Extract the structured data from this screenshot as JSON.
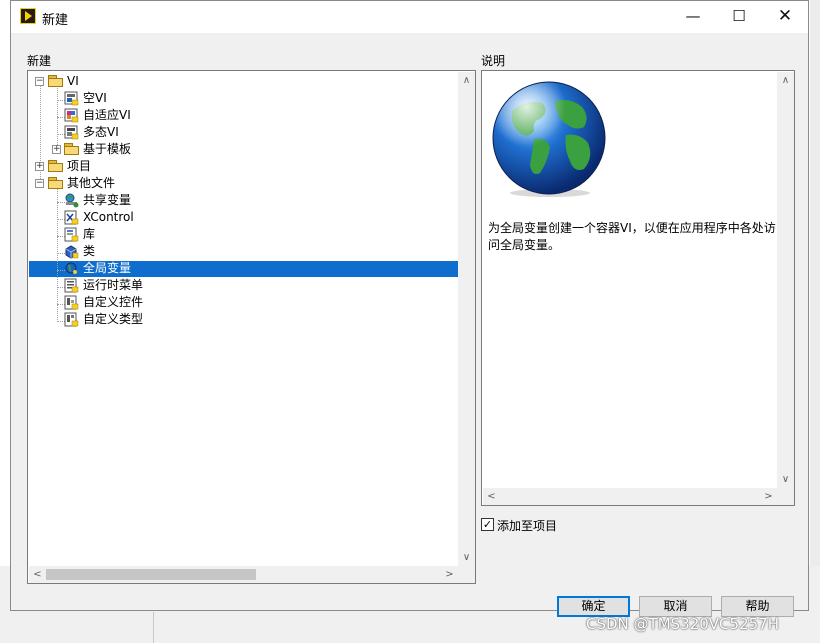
{
  "window": {
    "title": "新建",
    "minimize_glyph": "—",
    "maximize_glyph": "☐",
    "close_glyph": "✕"
  },
  "tree_section_label": "新建",
  "description_section_label": "说明",
  "tree": [
    {
      "label": "VI",
      "expanded": true,
      "icon": "folder-icon"
    },
    {
      "label": "空VI",
      "icon": "vi-icon"
    },
    {
      "label": "自适应VI",
      "icon": "adaptive-vi-icon"
    },
    {
      "label": "多态VI",
      "icon": "polymorphic-vi-icon"
    },
    {
      "label": "基于模板",
      "expanded": false,
      "icon": "folder-icon"
    },
    {
      "label": "项目",
      "expanded": false,
      "icon": "folder-icon"
    },
    {
      "label": "其他文件",
      "expanded": true,
      "icon": "folder-icon"
    },
    {
      "label": "共享变量",
      "icon": "shared-variable-icon"
    },
    {
      "label": "XControl",
      "icon": "xcontrol-icon"
    },
    {
      "label": "库",
      "icon": "library-icon"
    },
    {
      "label": "类",
      "icon": "class-icon"
    },
    {
      "label": "全局变量",
      "icon": "global-variable-icon",
      "selected": true
    },
    {
      "label": "运行时菜单",
      "icon": "runtime-menu-icon"
    },
    {
      "label": "自定义控件",
      "icon": "custom-control-icon"
    },
    {
      "label": "自定义类型",
      "icon": "custom-type-icon"
    }
  ],
  "description": {
    "text": "为全局变量创建一个容器VI，以便在应用程序中各处访问全局变量。",
    "image_icon": "globe-icon"
  },
  "add_to_project": {
    "label": "添加至项目",
    "checked": true
  },
  "buttons": {
    "ok": "确定",
    "cancel": "取消",
    "help": "帮助"
  },
  "watermark": "CSDN @TMS320VC5257H",
  "colors": {
    "selection": "#0f6ecd",
    "default_button_border": "#0078d7"
  }
}
